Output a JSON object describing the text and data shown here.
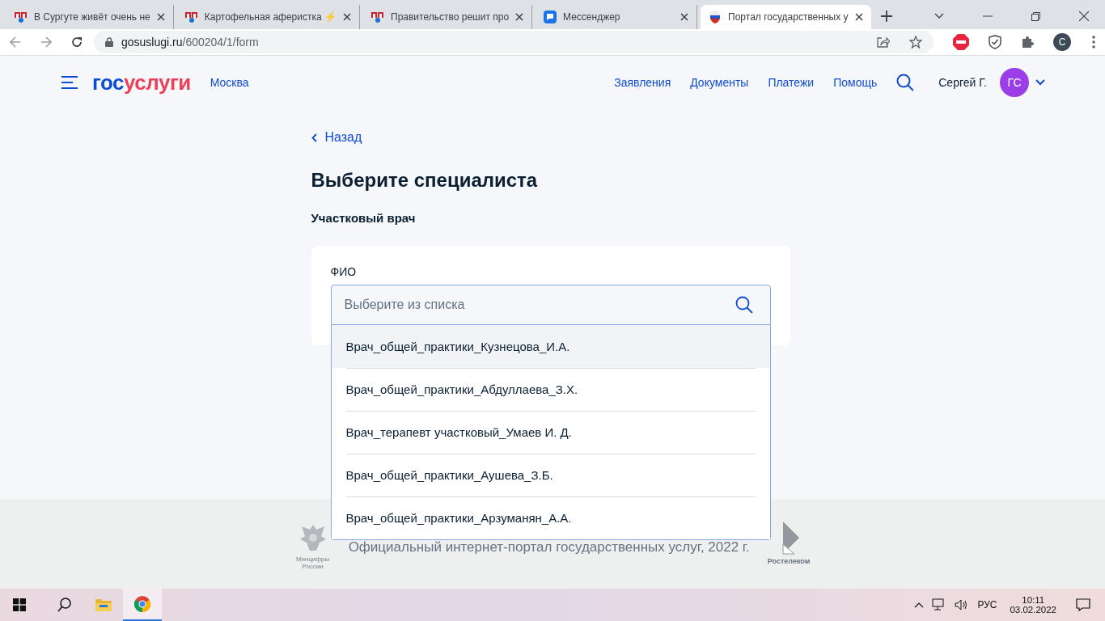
{
  "browser": {
    "tabs": [
      {
        "kind": "yap",
        "title": "В Сургуте живёт очень не",
        "selected": false
      },
      {
        "kind": "yap",
        "title": "Картофельная аферистка ⚡",
        "selected": false
      },
      {
        "kind": "yap",
        "title": "Правительство решит про",
        "selected": false
      },
      {
        "kind": "messenger",
        "title": "Мессенджер",
        "selected": false
      },
      {
        "kind": "flag",
        "title": "Портал государственных у",
        "selected": true
      }
    ],
    "address": {
      "host": "gosuslugi.ru",
      "path": "/600204/1/form"
    },
    "profile_initial": "C"
  },
  "header": {
    "logo": {
      "part1": "гос",
      "part2": "услуги"
    },
    "region": "Москва",
    "nav": [
      "Заявления",
      "Документы",
      "Платежи",
      "Помощь"
    ],
    "user": {
      "name": "Сергей Г.",
      "initials": "ГС"
    }
  },
  "page": {
    "back": "Назад",
    "title": "Выберите специалиста",
    "subtitle": "Участковый врач",
    "field": {
      "label": "ФИО",
      "placeholder": "Выберите из списка"
    },
    "options": [
      {
        "label": "Врач_общей_практики_Кузнецова_И.А.",
        "selected": true
      },
      {
        "label": "Врач_общей_практики_Абдуллаева_З.Х.",
        "selected": false
      },
      {
        "label": "Врач_терапевт участковый_Умаев И. Д.",
        "selected": false
      },
      {
        "label": "Врач_общей_практики_Аушева_З.Б.",
        "selected": false
      },
      {
        "label": "Врач_общей_практики_Арзуманян_А.А.",
        "selected": false
      }
    ]
  },
  "footer": {
    "ministry": "Минцифры России",
    "text": "Официальный интернет-портал государственных услуг, 2022 г.",
    "operator": "Ростелеком"
  },
  "taskbar": {
    "language": "РУС",
    "time": "10:11",
    "date": "03.02.2022"
  }
}
